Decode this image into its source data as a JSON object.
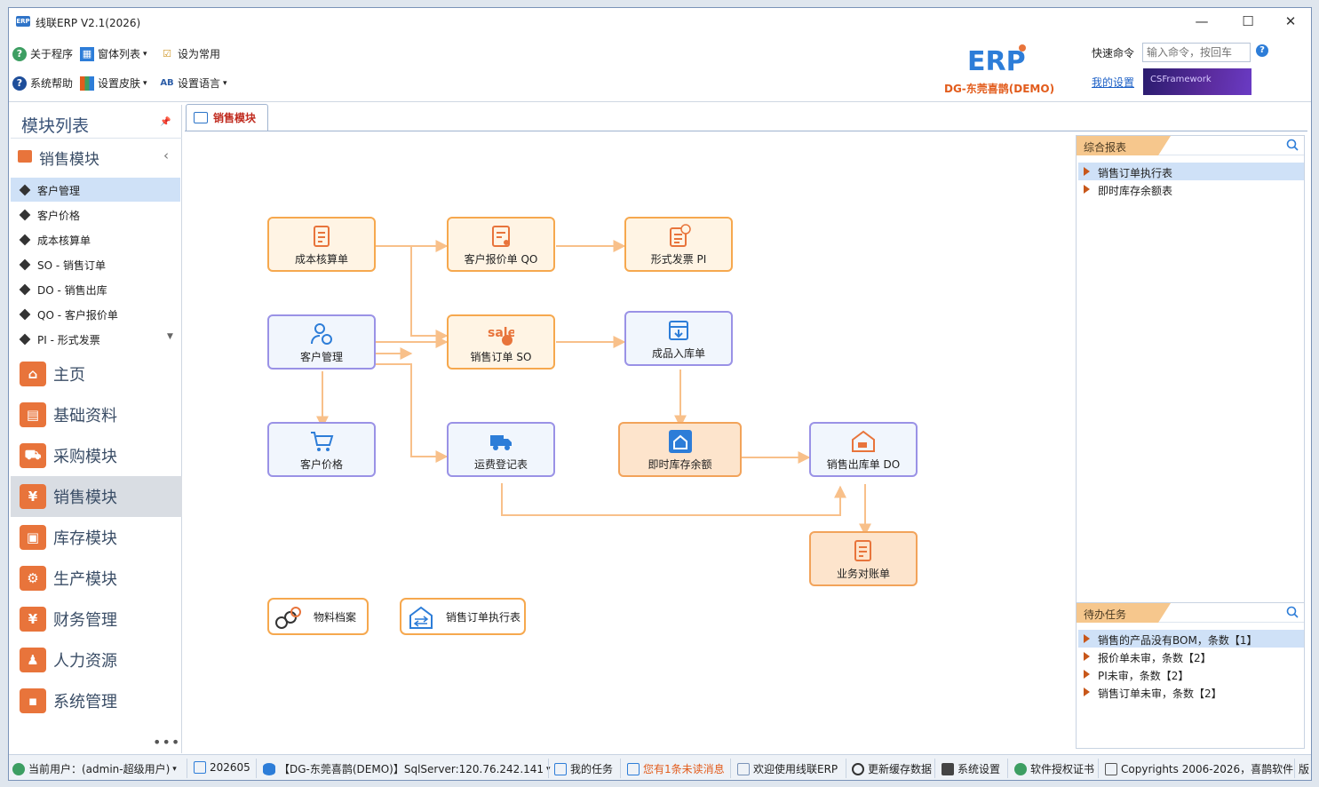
{
  "window": {
    "title": "线联ERP V2.1(2026)",
    "app_icon_text": "ERP",
    "minimize": "—",
    "maximize": "☐",
    "close": "✕"
  },
  "toolbar": {
    "about": "关于程序",
    "window_list": "窗体列表",
    "set_common": "设为常用",
    "help": "系统帮助",
    "skin": "设置皮肤",
    "language": "设置语言"
  },
  "header": {
    "logo": "ERP",
    "company": "DG-东莞喜鹊(DEMO)",
    "quick_cmd_label": "快速命令",
    "quick_cmd_placeholder": "输入命令，按回车",
    "my_settings": "我的设置",
    "framework": "CSFramework"
  },
  "sidebar": {
    "title": "模块列表",
    "group": "销售模块",
    "sub_items": [
      {
        "label": "客户管理",
        "selected": true
      },
      {
        "label": "客户价格"
      },
      {
        "label": "成本核算单"
      },
      {
        "label": "SO - 销售订单"
      },
      {
        "label": "DO - 销售出库"
      },
      {
        "label": "QO - 客户报价单"
      },
      {
        "label": "PI - 形式发票"
      }
    ],
    "nav_items": [
      {
        "label": "主页",
        "color": "#e8743b",
        "icon": "home-icon"
      },
      {
        "label": "基础资料",
        "color": "#e8743b",
        "icon": "folder-icon"
      },
      {
        "label": "采购模块",
        "color": "#e8743b",
        "icon": "cart-icon"
      },
      {
        "label": "销售模块",
        "color": "#e8743b",
        "icon": "sales-bag-icon",
        "active": true
      },
      {
        "label": "库存模块",
        "color": "#e8743b",
        "icon": "warehouse-icon"
      },
      {
        "label": "生产模块",
        "color": "#e8743b",
        "icon": "gears-icon"
      },
      {
        "label": "财务管理",
        "color": "#e8743b",
        "icon": "money-bag-icon"
      },
      {
        "label": "人力资源",
        "color": "#e8743b",
        "icon": "people-icon"
      },
      {
        "label": "系统管理",
        "color": "#e8743b",
        "icon": "settings-icon"
      }
    ],
    "more": "•••"
  },
  "tab": {
    "label": "销售模块"
  },
  "flow": {
    "nodes": {
      "cost": "成本核算单",
      "quote": "客户报价单 QO",
      "pi": "形式发票 PI",
      "customer": "客户管理",
      "so": "销售订单 SO",
      "finished_in": "成品入库单",
      "price": "客户价格",
      "freight": "运费登记表",
      "stock": "即时库存余额",
      "do": "销售出库单 DO",
      "statement": "业务对账单"
    },
    "sale_badge": "sale",
    "shortcuts": {
      "material": "物料档案",
      "so_exec": "销售订单执行表"
    }
  },
  "reports": {
    "title": "综合报表",
    "items": [
      {
        "label": "销售订单执行表",
        "selected": true
      },
      {
        "label": "即时库存余额表"
      }
    ]
  },
  "tasks": {
    "title": "待办任务",
    "items": [
      {
        "label": "销售的产品没有BOM，条数【1】",
        "selected": true
      },
      {
        "label": "报价单未审，条数【2】"
      },
      {
        "label": "PI未审，条数【2】"
      },
      {
        "label": "销售订单未审，条数【2】"
      }
    ]
  },
  "status_bar": {
    "user": "当前用户：(admin-超级用户)",
    "period": "202605",
    "db": "【DG-东莞喜鹊(DEMO)】SqlServer:120.76.242.141",
    "my_tasks": "我的任务",
    "messages": "您有1条未读消息",
    "welcome": "欢迎使用线联ERP",
    "refresh": "更新缓存数据",
    "sys_settings": "系统设置",
    "license": "软件授权证书",
    "copyright": "Copyrights 2006-2026，喜鹊软件",
    "version_cut": "版",
    "message_color": "#e25c1c"
  }
}
